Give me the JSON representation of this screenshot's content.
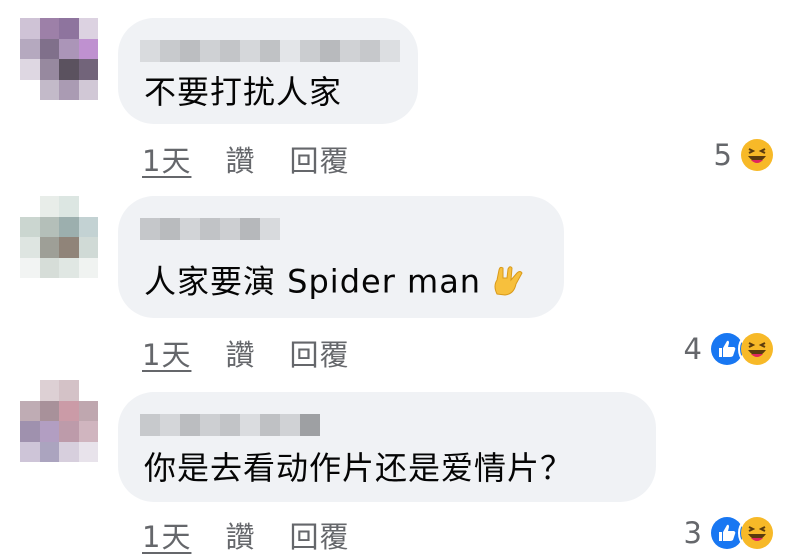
{
  "comments": [
    {
      "text": "不要打扰人家",
      "actions": {
        "time": "1天",
        "like": "讚",
        "reply": "回覆"
      },
      "reaction_count": "5",
      "reactions": [
        "haha-icon"
      ]
    },
    {
      "text": "人家要演 Spider man",
      "text_emoji": "rock-hand-emoji",
      "actions": {
        "time": "1天",
        "like": "讚",
        "reply": "回覆"
      },
      "reaction_count": "4",
      "reactions": [
        "like-icon",
        "haha-icon"
      ]
    },
    {
      "text": "你是去看动作片还是爱情片？",
      "actions": {
        "time": "1天",
        "like": "讚",
        "reply": "回覆"
      },
      "reaction_count": "3",
      "reactions": [
        "like-icon",
        "haha-icon"
      ]
    }
  ],
  "colors": {
    "bubble": "#f0f2f5",
    "secondary_text": "#65676b",
    "like_blue": "#1877f2",
    "haha_yellow": "#f7b928"
  }
}
